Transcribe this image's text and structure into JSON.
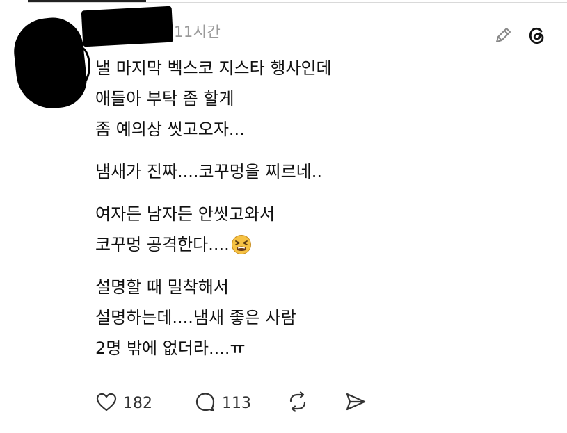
{
  "header": {
    "time": "11시간"
  },
  "post": {
    "paragraphs": [
      [
        "낼 마지막 벡스코 지스타 행사인데",
        "애들아 부탁 좀 할게",
        "좀 예의상 씻고오자..."
      ],
      [
        "냄새가 진짜....코꾸멍을 찌르네.."
      ],
      [
        "여자든 남자든 안씻고와서",
        "코꾸멍 공격한다...."
      ],
      [
        "설명할 때 밀착해서",
        "설명하는데....냄새 좋은 사람",
        "2명 밖에 없더라....ㅠ"
      ]
    ],
    "emoji": "tired-face-emoji"
  },
  "actions": {
    "like_count": "182",
    "reply_count": "113"
  },
  "icons": {
    "edit": "pencil-icon",
    "brand": "threads-logo-icon",
    "like": "heart-icon",
    "reply": "speech-bubble-icon",
    "repost": "repost-icon",
    "share": "send-icon"
  },
  "colors": {
    "text": "#111111",
    "muted": "#9a9a9a",
    "icon": "#333333"
  }
}
